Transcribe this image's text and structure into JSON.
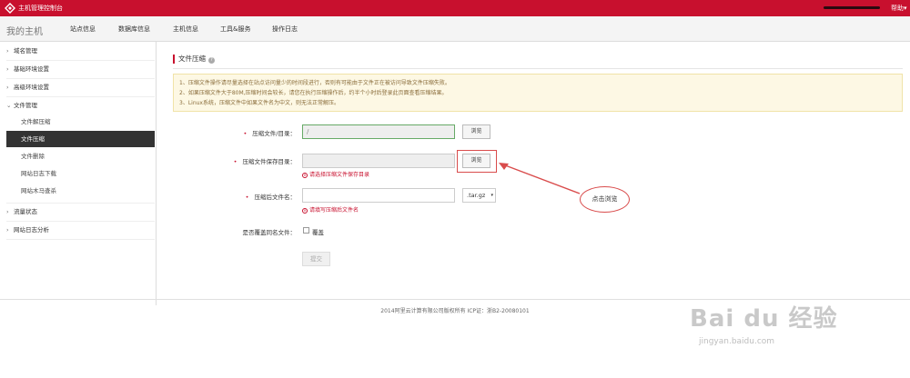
{
  "topbar": {
    "title": "主机管理控制台",
    "help": "帮助▾"
  },
  "nav": {
    "brand": "我的主机",
    "items": [
      "站点信息",
      "数据库信息",
      "主机信息",
      "工具&服务",
      "操作日志"
    ]
  },
  "sidebar": {
    "groups": [
      "域名管理",
      "基础环境设置",
      "高级环境设置",
      "文件管理"
    ],
    "sub_items": [
      "文件解压缩",
      "文件压缩",
      "文件删除",
      "网站日志下载",
      "网站木马查杀"
    ],
    "bottom_groups": [
      "流量状态",
      "网站日志分析"
    ]
  },
  "section": {
    "title": "文件压缩",
    "help_glyph": "?"
  },
  "notice": [
    "1、压缩文件操作请尽量选择在站点访问量少的时间段进行，否则有可能由于文件正在被访问导致文件压缩失败。",
    "2、如果压缩文件大于80M,压缩时间会较长，请您在执行压缩操作后，约半个小时后登录此页面查看压缩结果。",
    "3、Linux系统，压缩文件中如果文件名为中文，则无法正常解压。"
  ],
  "form": {
    "source_label": "压缩文件/目录：",
    "source_value": "/",
    "browse1": "浏览",
    "save_label": "压缩文件保存目录：",
    "browse2": "浏览",
    "save_error": "请选择压缩文件保存目录",
    "name_label": "压缩后文件名：",
    "name_value": "",
    "ext_value": ".tar.gz",
    "name_error": "请填写压缩后文件名",
    "overwrite_label": "是否覆盖同名文件：",
    "overwrite_option": "覆盖",
    "submit": "提交"
  },
  "footer": {
    "text": "2014阿里云计算有限公司版权所有 ICP证：浙B2-20080101"
  },
  "annotation": {
    "bubble": "点击浏览"
  },
  "watermark": {
    "main": "Bai du 经验",
    "url": "jingyan.baidu.com"
  },
  "colors": {
    "brand_red": "#c8102e",
    "notice_bg": "#fdf8e4",
    "annotation_red": "#d94c4c"
  }
}
